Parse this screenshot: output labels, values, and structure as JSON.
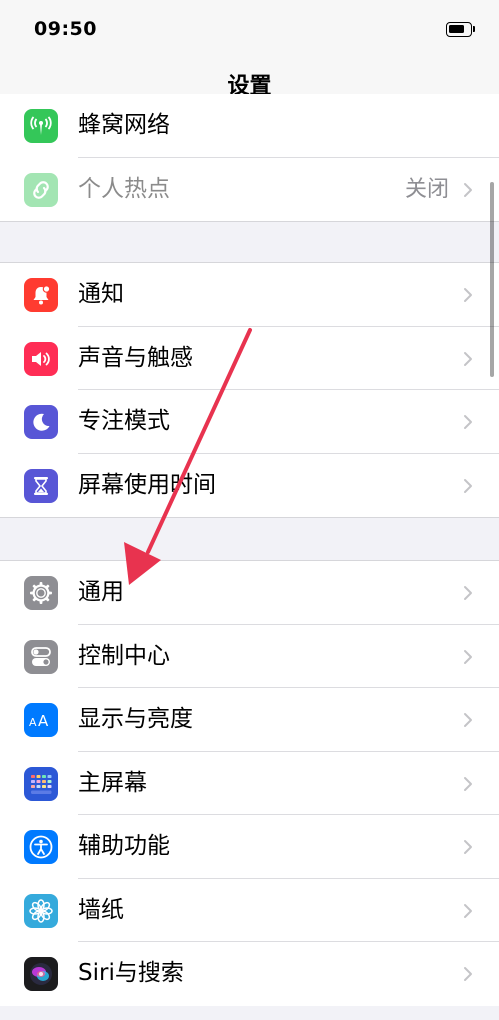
{
  "status_bar": {
    "time": "09:50"
  },
  "nav": {
    "title": "设置"
  },
  "colors": {
    "cellular": "#34c759",
    "hotspot": "#34c759",
    "notifications": "#ff3b30",
    "sounds": "#ff2d55",
    "focus": "#5856d6",
    "screen_time": "#5856d6",
    "general": "#8e8e93",
    "control_center": "#8e8e93",
    "display": "#007aff",
    "home_screen": "#2c58d6",
    "accessibility": "#007aff",
    "wallpaper": "#35aadc",
    "siri": "#1c1c1e",
    "annotation_arrow": "#e8334f"
  },
  "groups": [
    {
      "items": [
        {
          "label": "蜂窝网络",
          "icon": "antenna-icon"
        },
        {
          "label": "个人热点",
          "value": "关闭",
          "icon": "hotspot-chain-icon"
        }
      ]
    },
    {
      "items": [
        {
          "label": "通知",
          "icon": "bell-icon"
        },
        {
          "label": "声音与触感",
          "icon": "speaker-icon"
        },
        {
          "label": "专注模式",
          "icon": "moon-icon"
        },
        {
          "label": "屏幕使用时间",
          "icon": "hourglass-icon"
        }
      ]
    },
    {
      "items": [
        {
          "label": "通用",
          "icon": "gear-icon"
        },
        {
          "label": "控制中心",
          "icon": "toggles-icon"
        },
        {
          "label": "显示与亮度",
          "icon": "text-size-icon"
        },
        {
          "label": "主屏幕",
          "icon": "app-grid-icon"
        },
        {
          "label": "辅助功能",
          "icon": "accessibility-icon"
        },
        {
          "label": "墙纸",
          "icon": "flower-icon"
        },
        {
          "label": "Siri与搜索",
          "icon": "siri-icon"
        }
      ]
    }
  ]
}
